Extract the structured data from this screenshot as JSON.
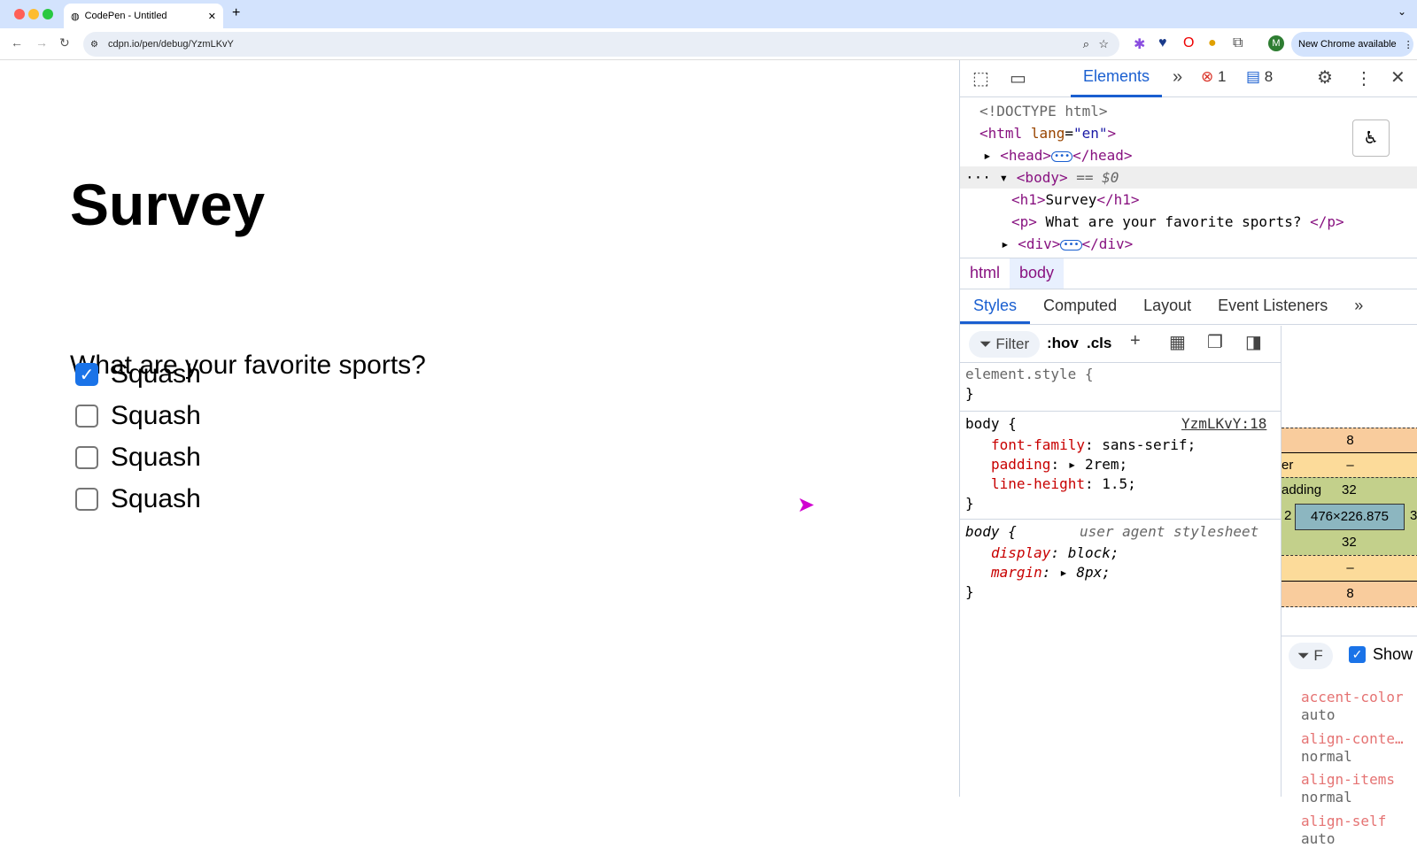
{
  "browser": {
    "tab_title": "CodePen - Untitled",
    "url": "cdpn.io/pen/debug/YzmLKvY",
    "update_label": "New Chrome available",
    "profile_initial": "M"
  },
  "page": {
    "heading": "Survey",
    "question": "What are your favorite sports?",
    "options": [
      {
        "label": "Squash",
        "checked": true
      },
      {
        "label": "Squash",
        "checked": false
      },
      {
        "label": "Squash",
        "checked": false
      },
      {
        "label": "Squash",
        "checked": false
      }
    ]
  },
  "devtools": {
    "tab_elements": "Elements",
    "errors": "1",
    "messages": "8",
    "dom": {
      "doctype": "<!DOCTYPE html>",
      "html_open": "<html",
      "lang_attr": "lang",
      "lang_val": "\"en\"",
      "head": "<head>",
      "head_close": "</head>",
      "body": "<body>",
      "body_eq": "== $0",
      "h1": "<h1>",
      "h1_text": "Survey",
      "h1_close": "</h1>",
      "p": "<p>",
      "p_text": " What are your favorite sports? ",
      "p_close": "</p>",
      "div": "<div>",
      "div_close": "</div>"
    },
    "breadcrumbs": [
      "html",
      "body"
    ],
    "style_tabs": [
      "Styles",
      "Computed",
      "Layout",
      "Event Listeners"
    ],
    "filter_placeholder": "Filter",
    "hov": ":hov",
    "cls": ".cls",
    "rules": {
      "element_style": "element.style {",
      "body_source": "YzmLKvY:18",
      "ua": "user agent stylesheet",
      "body_props": [
        {
          "n": "font-family",
          "v": "sans-serif;"
        },
        {
          "n": "padding",
          "v": "2rem;"
        },
        {
          "n": "line-height",
          "v": "1.5;"
        }
      ],
      "ua_props": [
        {
          "n": "display",
          "v": "block;"
        },
        {
          "n": "margin",
          "v": "8px;"
        }
      ]
    },
    "box_model": {
      "margin_top": "8",
      "border_label": "er",
      "border_top": "–",
      "padding_label": "adding",
      "padding_top": "32",
      "left": "2",
      "right": "3",
      "content": "476×226.875",
      "padding_bottom": "32",
      "border_bottom": "–",
      "margin_bottom": "8"
    },
    "computed": {
      "show_label": "Show",
      "filter": "F",
      "props": [
        {
          "n": "accent-color",
          "v": "auto"
        },
        {
          "n": "align-conte…",
          "v": "normal"
        },
        {
          "n": "align-items",
          "v": "normal"
        },
        {
          "n": "align-self",
          "v": "auto"
        }
      ]
    }
  }
}
